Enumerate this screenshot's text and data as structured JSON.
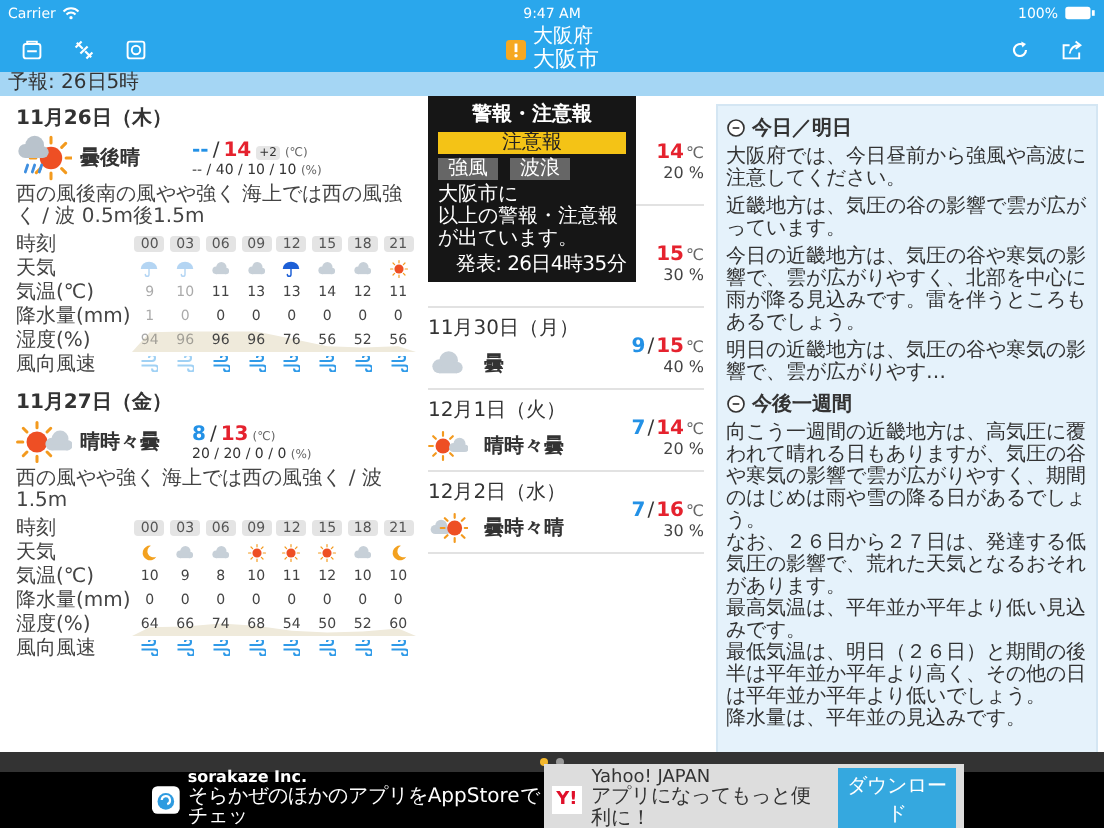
{
  "status_bar": {
    "carrier": "Carrier",
    "time": "9:47 AM",
    "battery": "100%"
  },
  "toolbar": {
    "warning": true,
    "prefecture": "大阪府",
    "city": "大阪市"
  },
  "forecast_time": "予報: 26日5時",
  "days": [
    {
      "date": "11月26日（木）",
      "kind": "cloud_sun_rain",
      "weather": "曇後晴",
      "low": "--",
      "sep": "/",
      "high": "14",
      "high_diff": "+2",
      "temp_unit": "(℃)",
      "pops": "-- / 40 / 10 / 10",
      "pop_unit": "(%)",
      "wind_wave": "西の風後南の風やや強く 海上では西の風強く / 波 0.5m後1.5m",
      "row_labels": [
        "時刻",
        "天気",
        "気温(℃)",
        "降水量(mm)",
        "湿度(%)",
        "風向風速"
      ],
      "hours": [
        {
          "time": "00",
          "kind": "rain",
          "temp": "9",
          "precip": "1",
          "humidity": "94",
          "past": true
        },
        {
          "time": "03",
          "kind": "rain",
          "temp": "10",
          "precip": "0",
          "humidity": "96",
          "past": true
        },
        {
          "time": "06",
          "kind": "cloudy",
          "temp": "11",
          "precip": "0",
          "humidity": "96",
          "past": false
        },
        {
          "time": "09",
          "kind": "cloudy",
          "temp": "13",
          "precip": "0",
          "humidity": "96",
          "past": false
        },
        {
          "time": "12",
          "kind": "heavy_rain",
          "temp": "13",
          "precip": "0",
          "humidity": "76",
          "past": false
        },
        {
          "time": "15",
          "kind": "cloudy",
          "temp": "14",
          "precip": "0",
          "humidity": "56",
          "past": false
        },
        {
          "time": "18",
          "kind": "cloudy",
          "temp": "12",
          "precip": "0",
          "humidity": "52",
          "past": false
        },
        {
          "time": "21",
          "kind": "sunny",
          "temp": "11",
          "precip": "0",
          "humidity": "56",
          "past": false
        }
      ]
    },
    {
      "date": "11月27日（金）",
      "kind": "sun_cloud",
      "weather": "晴時々曇",
      "low": "8",
      "sep": "/",
      "high": "13",
      "temp_unit": "(℃)",
      "pops": "20 / 20 / 0 / 0",
      "pop_unit": "(%)",
      "wind_wave": "西の風やや強く 海上では西の風強く / 波 1.5m",
      "row_labels": [
        "時刻",
        "天気",
        "気温(℃)",
        "降水量(mm)",
        "湿度(%)",
        "風向風速"
      ],
      "hours": [
        {
          "time": "00",
          "kind": "clear_night",
          "temp": "10",
          "precip": "0",
          "humidity": "64",
          "past": false
        },
        {
          "time": "03",
          "kind": "cloudy",
          "temp": "9",
          "precip": "0",
          "humidity": "66",
          "past": false
        },
        {
          "time": "06",
          "kind": "cloudy",
          "temp": "8",
          "precip": "0",
          "humidity": "74",
          "past": false
        },
        {
          "time": "09",
          "kind": "sunny",
          "temp": "10",
          "precip": "0",
          "humidity": "68",
          "past": false
        },
        {
          "time": "12",
          "kind": "sunny",
          "temp": "11",
          "precip": "0",
          "humidity": "54",
          "past": false
        },
        {
          "time": "15",
          "kind": "sunny",
          "temp": "12",
          "precip": "0",
          "humidity": "50",
          "past": false
        },
        {
          "time": "18",
          "kind": "cloudy",
          "temp": "10",
          "precip": "0",
          "humidity": "52",
          "past": false
        },
        {
          "time": "21",
          "kind": "clear_night",
          "temp": "10",
          "precip": "0",
          "humidity": "60",
          "past": false
        }
      ]
    }
  ],
  "warning_popup": {
    "title": "警報・注意報",
    "level": "注意報",
    "items": [
      "強風",
      "波浪"
    ],
    "message_lines": [
      "大阪市に",
      "以上の警報・注意報が出ています。"
    ],
    "issued": "発表: 26日4時35分"
  },
  "week": [
    {
      "high": "14",
      "unit": "℃",
      "pop": "20 %"
    },
    {
      "high": "15",
      "unit": "℃",
      "pop": "30 %"
    },
    {
      "date": "11月30日（月）",
      "kind": "cloudy",
      "weather": "曇",
      "low": "9",
      "sep": "/",
      "high": "15",
      "unit": "℃",
      "pop": "40 %"
    },
    {
      "date": "12月1日（火）",
      "kind": "sun_cloud",
      "weather": "晴時々曇",
      "low": "7",
      "sep": "/",
      "high": "14",
      "unit": "℃",
      "pop": "20 %"
    },
    {
      "date": "12月2日（水）",
      "kind": "cloud_sun",
      "weather": "曇時々晴",
      "low": "7",
      "sep": "/",
      "high": "16",
      "unit": "℃",
      "pop": "30 %"
    }
  ],
  "outlook": [
    {
      "heading": "今日／明日",
      "kind": "spaced",
      "paragraphs": [
        "大阪府では、今日昼前から強風や高波に注意してください。",
        "近畿地方は、気圧の谷の影響で雲が広がっています。",
        "今日の近畿地方は、気圧の谷や寒気の影響で、雲が広がりやすく、北部を中心に雨が降る見込みです。雷を伴うところもあるでしょう。",
        "明日の近畿地方は、気圧の谷や寒気の影響で、雲が広がりやす…"
      ]
    },
    {
      "heading": "今後一週間",
      "kind": "lines",
      "paragraphs": [
        "向こう一週間の近畿地方は、高気圧に覆われて晴れる日もありますが、気圧の谷や寒気の影響で雲が広がりやすく、期間のはじめは雨や雪の降る日があるでしょう。",
        "なお、２６日から２７日は、発達する低気圧の影響で、荒れた天気となるおそれがあります。",
        "最高気温は、平年並か平年より低い見込みです。",
        "最低気温は、明日（２６日）と期間の後半は平年並か平年より高く、その他の日は平年並か平年より低いでしょう。",
        "降水量は、平年並の見込みです。"
      ]
    }
  ],
  "pages": [
    {
      "selected": true
    },
    {
      "selected": false
    }
  ],
  "ads": {
    "left": {
      "title": "sorakaze Inc.",
      "text": "そらかぜのほかのアプリをAppStoreでチェッ"
    },
    "right": {
      "logo": "Y!",
      "title": "Yahoo! JAPAN",
      "text": "アプリになってもっと便利に！",
      "button": "ダウンロード"
    }
  }
}
